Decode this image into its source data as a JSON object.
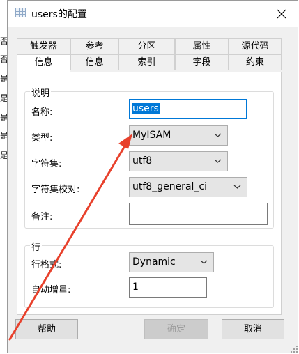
{
  "background": {
    "left_chars": [
      "否",
      "否",
      "是",
      "是",
      "是",
      "是",
      "是"
    ]
  },
  "dialog": {
    "title": "users的配置",
    "close_symbol": "✕"
  },
  "tabs_row1": [
    "触发器",
    "参考",
    "分区",
    "属性",
    "源代码"
  ],
  "tabs_row2": [
    "信息",
    "信息",
    "索引",
    "字段",
    "约束"
  ],
  "section_description": {
    "legend": "说明",
    "name_label": "名称:",
    "name_value": "users",
    "type_label": "类型:",
    "type_value": "MyISAM",
    "charset_label": "字符集:",
    "charset_value": "utf8",
    "collation_label": "字符集校对:",
    "collation_value": "utf8_general_ci",
    "comment_label": "备注:",
    "comment_value": ""
  },
  "section_row": {
    "legend": "行",
    "format_label": "行格式:",
    "format_value": "Dynamic",
    "autoinc_label": "自动增量:",
    "autoinc_value": "1"
  },
  "buttons": {
    "help": "帮助",
    "ok": "确定",
    "cancel": "取消"
  },
  "colors": {
    "annotation_arrow": "#e8412c",
    "selection": "#0078d7"
  }
}
